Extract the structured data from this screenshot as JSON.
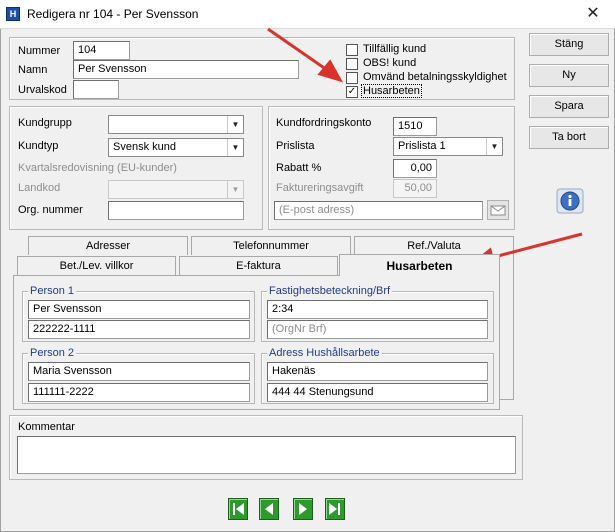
{
  "window": {
    "title": "Redigera nr 104 - Per Svensson",
    "app_icon_text": "H"
  },
  "customer": {
    "nummer_label": "Nummer",
    "nummer_value": "104",
    "namn_label": "Namn",
    "namn_value": "Per Svensson",
    "urvalskod_label": "Urvalskod",
    "urvalskod_value": ""
  },
  "flags": {
    "tillfallig_kund": "Tillfällig kund",
    "obs_kund": "OBS! kund",
    "omvand": "Omvänd betalningsskyldighet",
    "husarbeten": "Husarbeten",
    "husarbeten_checked": "✓"
  },
  "buttons": {
    "stang": "Stäng",
    "ny": "Ny",
    "spara": "Spara",
    "ta_bort": "Ta bort"
  },
  "group_left": {
    "kundgrupp_label": "Kundgrupp",
    "kundgrupp_value": "",
    "kundtyp_label": "Kundtyp",
    "kundtyp_value": "Svensk kund",
    "kvartal_label": "Kvartalsredovisning (EU-kunder)",
    "landkod_label": "Landkod",
    "landkod_value": "",
    "orgnr_label": "Org. nummer",
    "orgnr_value": ""
  },
  "group_right": {
    "kundford_label": "Kundfordringskonto",
    "kundford_value": "1510",
    "prislista_label": "Prislista",
    "prislista_value": "Prislista 1",
    "rabatt_label": "Rabatt %",
    "rabatt_value": "0,00",
    "fakt_label": "Faktureringsavgift",
    "fakt_value": "50,00",
    "email_placeholder": "(E-post adress)"
  },
  "tabs": {
    "row1": [
      "Adresser",
      "Telefonnummer",
      "Ref./Valuta"
    ],
    "row2": [
      "Bet./Lev. villkor",
      "E-faktura",
      "Husarbeten"
    ]
  },
  "husarbeten": {
    "person1_legend": "Person 1",
    "person1_name": "Per Svensson",
    "person1_pnr": "222222-1111",
    "person2_legend": "Person 2",
    "person2_name": "Maria Svensson",
    "person2_pnr": "111111-2222",
    "fastighet_legend": "Fastighetsbeteckning/Brf",
    "fastighet_value": "2:34",
    "orgnr_brf_placeholder": "(OrgNr Brf)",
    "adress_legend": "Adress Hushållsarbete",
    "adress_street": "Hakenäs",
    "adress_postal": "444 44 Stenungsund"
  },
  "kommentar": {
    "label": "Kommentar",
    "value": ""
  },
  "colors": {
    "arrow": "#d9342b",
    "nav_green": "#2e9a2e",
    "legend_blue": "#1e3c8e"
  }
}
